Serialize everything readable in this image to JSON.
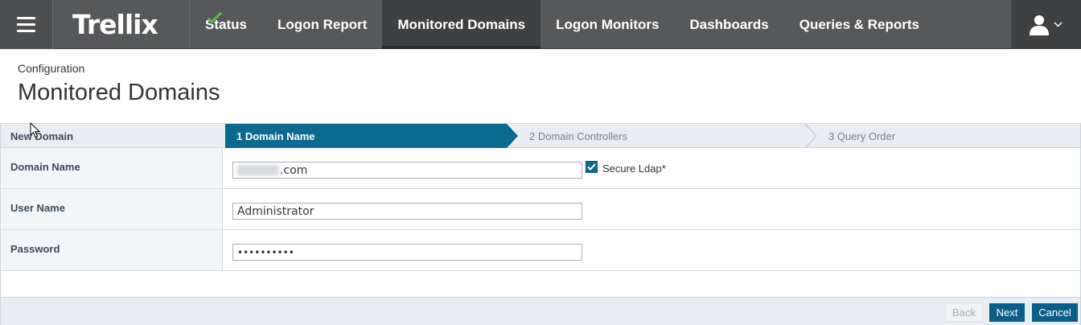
{
  "brand": {
    "name": "Trellix",
    "accent": "#5fb84a"
  },
  "nav": {
    "items": [
      {
        "label": "Status"
      },
      {
        "label": "Logon Report"
      },
      {
        "label": "Monitored Domains",
        "active": true
      },
      {
        "label": "Logon Monitors"
      },
      {
        "label": "Dashboards"
      },
      {
        "label": "Queries & Reports"
      }
    ],
    "user_icon": "user-icon",
    "menu_icon": "hamburger-icon"
  },
  "header": {
    "breadcrumb": "Configuration",
    "title": "Monitored Domains"
  },
  "wizard": {
    "section_label": "New Domain",
    "steps": [
      {
        "label": "1 Domain Name",
        "active": true
      },
      {
        "label": "2 Domain Controllers"
      },
      {
        "label": "3 Query Order"
      }
    ],
    "active_color": "#0c6a8f"
  },
  "form": {
    "domain_name": {
      "label": "Domain Name",
      "value_suffix": ".com"
    },
    "secure_ldap": {
      "label": "Secure Ldap*",
      "checked": true
    },
    "user_name": {
      "label": "User Name",
      "value": "Administrator"
    },
    "password": {
      "label": "Password",
      "value": "••••••••••"
    }
  },
  "footer": {
    "back_label": "Back",
    "next_label": "Next",
    "cancel_label": "Cancel"
  }
}
